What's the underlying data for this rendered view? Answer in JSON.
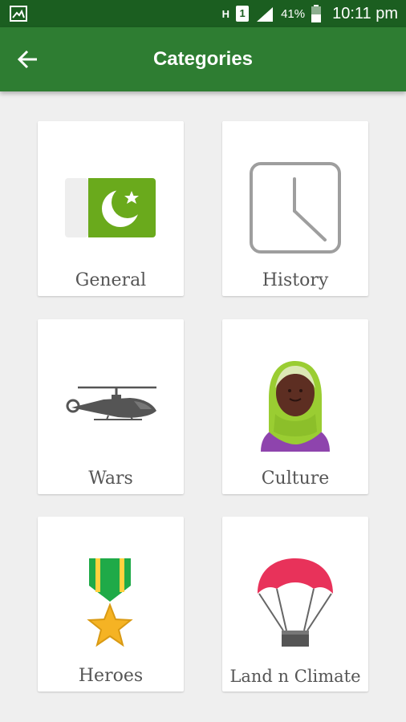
{
  "status_bar": {
    "network_label": "H",
    "sim_label": "1",
    "battery_percent": "41%",
    "time": "10:11 pm"
  },
  "app_bar": {
    "title": "Categories",
    "back_icon": "arrow-left-icon"
  },
  "categories": [
    {
      "label": "General",
      "icon": "pakistan-flag-icon"
    },
    {
      "label": "History",
      "icon": "clock-icon"
    },
    {
      "label": "Wars",
      "icon": "helicopter-icon"
    },
    {
      "label": "Culture",
      "icon": "woman-hijab-icon"
    },
    {
      "label": "Heroes",
      "icon": "medal-icon"
    },
    {
      "label": "Land n Climate",
      "icon": "parachute-icon"
    }
  ],
  "colors": {
    "status_bar": "#1b5e20",
    "app_bar": "#2e7d32",
    "flag_green": "#6aaa1c",
    "background": "#efefef"
  }
}
